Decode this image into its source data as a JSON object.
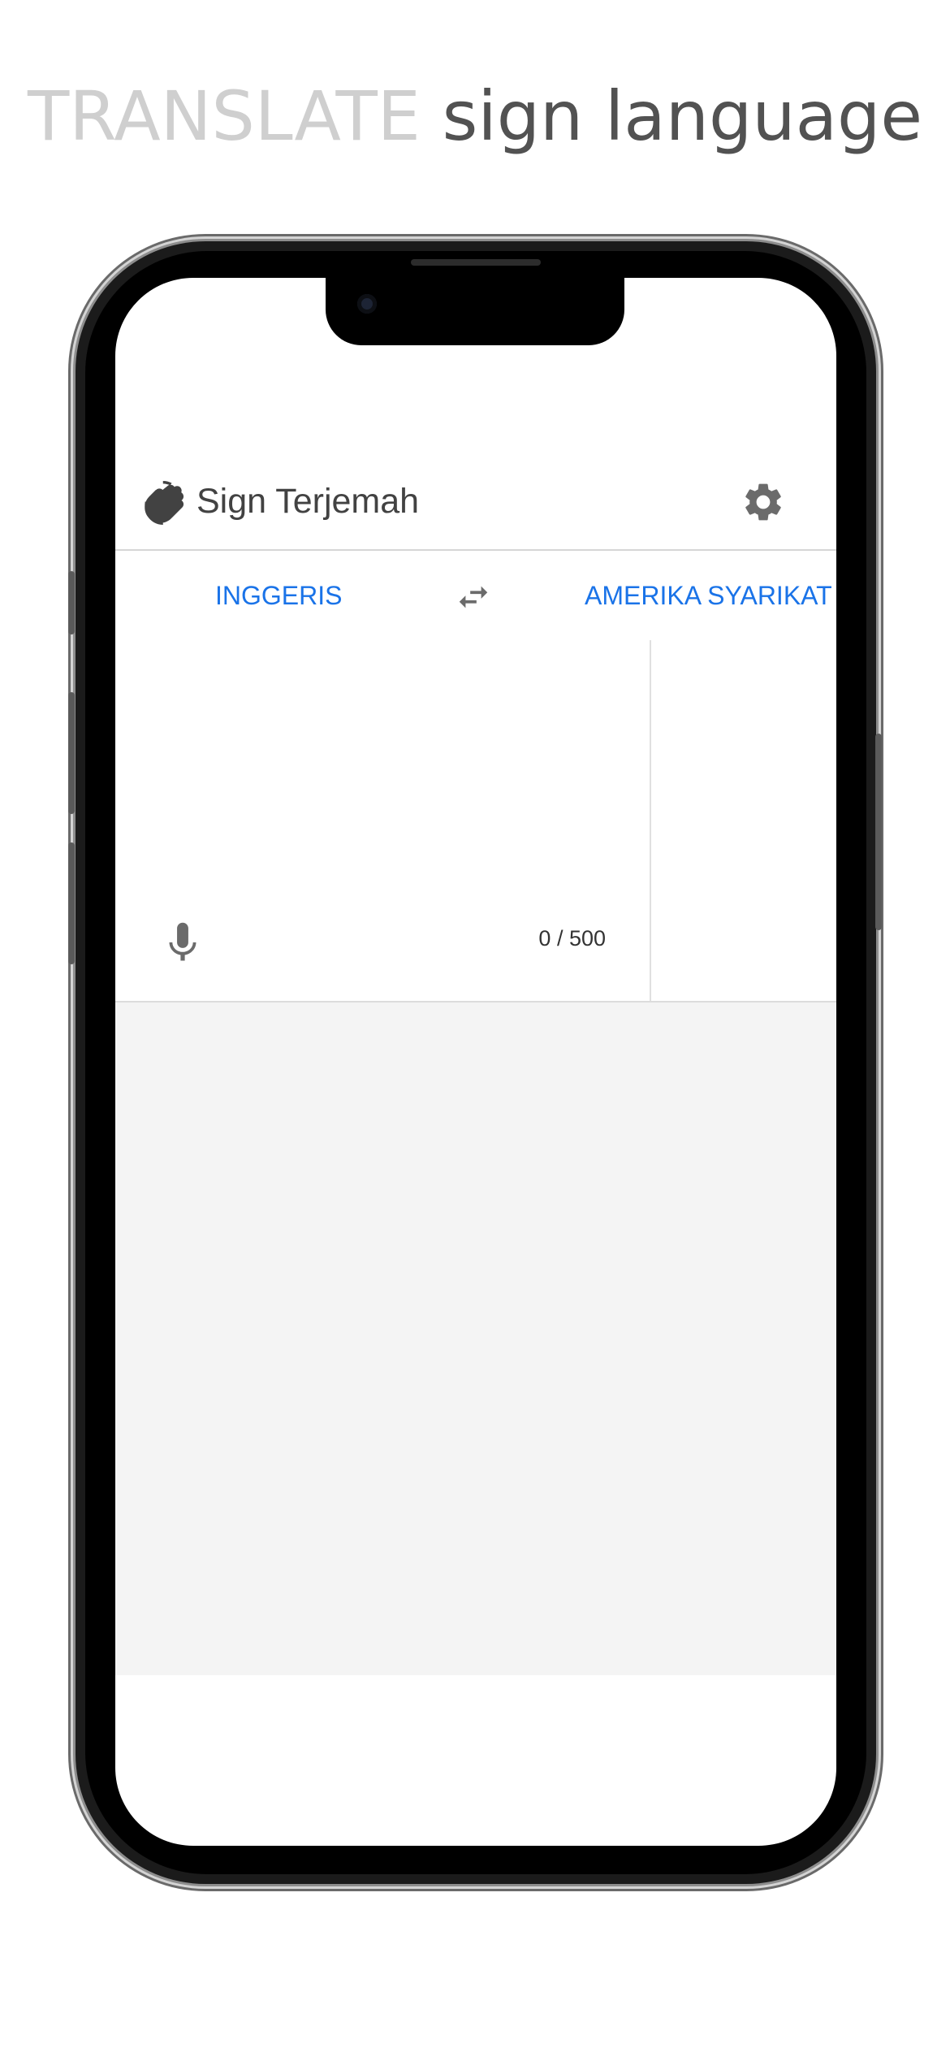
{
  "headline": {
    "light": "TRANSLATE",
    "dark": "sign language"
  },
  "app": {
    "title": "Sign Terjemah",
    "logo_icon": "waving-hands-icon",
    "settings_icon": "gear-icon"
  },
  "languages": {
    "source": "INGGERIS",
    "target": "AMERIKA SYARIKAT",
    "swap_icon": "swap-horizontal-icon"
  },
  "input": {
    "value": "",
    "char_count": "0 / 500",
    "mic_icon": "microphone-icon"
  },
  "colors": {
    "accent": "#1a73e8",
    "title_text": "#424242",
    "headline_light": "#cfcfcf",
    "headline_dark": "#525252",
    "panel_gray": "#f4f4f4"
  }
}
